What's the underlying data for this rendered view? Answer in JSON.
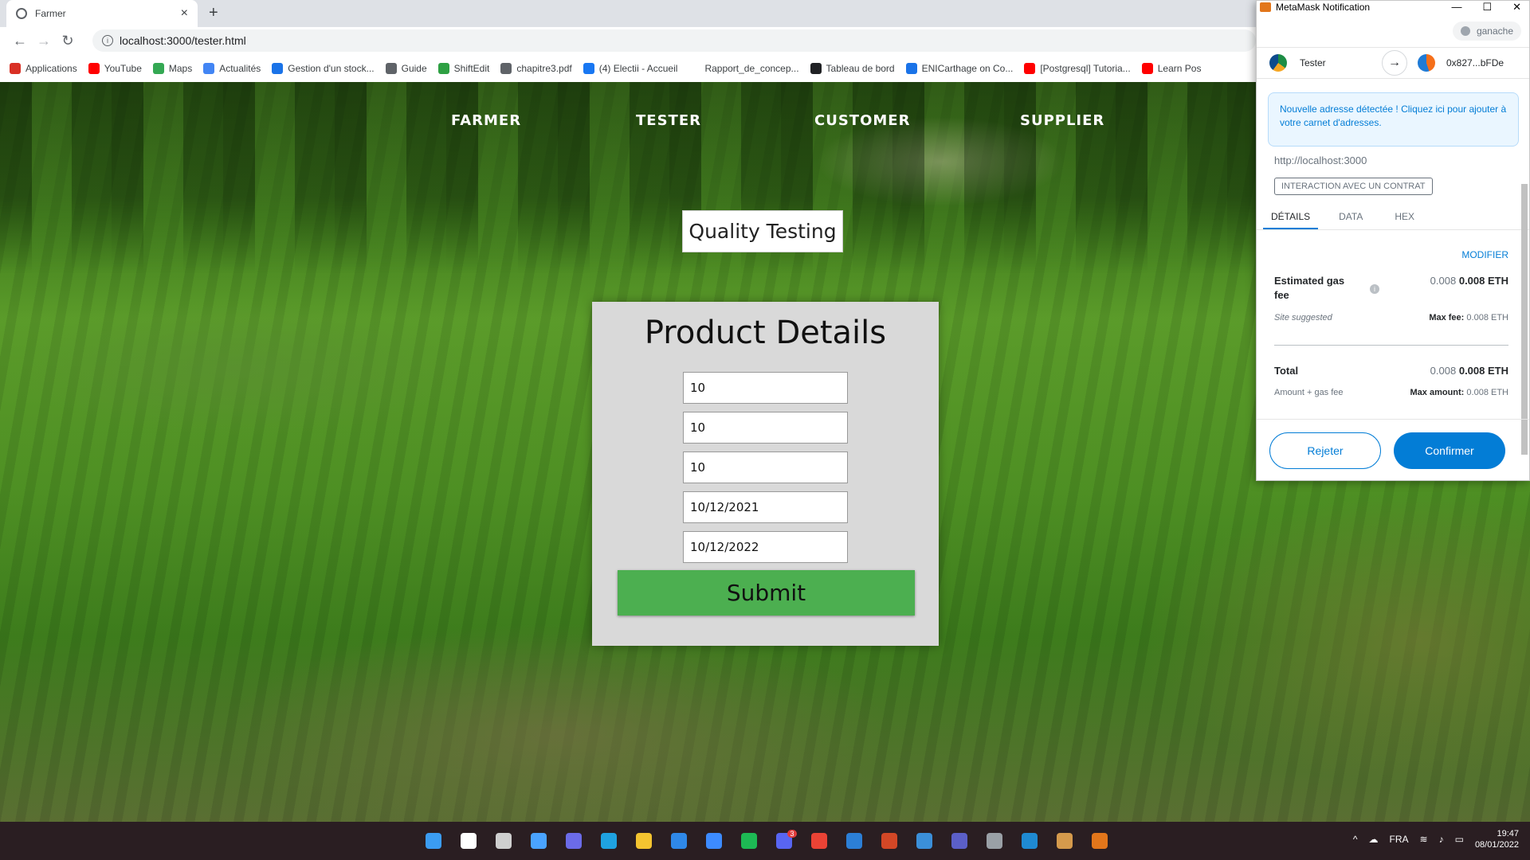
{
  "browser": {
    "tab_title": "Farmer",
    "new_tab": "+",
    "tab_close": "×",
    "url": "localhost:3000/tester.html",
    "nav": {
      "back": "←",
      "forward": "→",
      "reload": "↻"
    },
    "bookmarks": [
      {
        "label": "Applications",
        "color": "#d93025"
      },
      {
        "label": "YouTube",
        "color": "#ff0000"
      },
      {
        "label": "Maps",
        "color": "#34a853"
      },
      {
        "label": "Actualités",
        "color": "#4285f4"
      },
      {
        "label": "Gestion d'un stock...",
        "color": "#1a73e8"
      },
      {
        "label": "Guide",
        "color": "#5f6368"
      },
      {
        "label": "ShiftEdit",
        "color": "#2ea043"
      },
      {
        "label": "chapitre3.pdf",
        "color": "#5f6368"
      },
      {
        "label": "(4) Electii - Accueil",
        "color": "#1877f2"
      },
      {
        "label": "Rapport_de_concep...",
        "color": "#ffffff"
      },
      {
        "label": "Tableau de bord",
        "color": "#202124"
      },
      {
        "label": "ENICarthage on Co...",
        "color": "#1a73e8"
      },
      {
        "label": "[Postgresql] Tutoria...",
        "color": "#ff0000"
      },
      {
        "label": "Learn Pos",
        "color": "#ff0000"
      }
    ]
  },
  "page": {
    "nav": [
      "FARMER",
      "TESTER",
      "CUSTOMER",
      "SUPPLIER"
    ],
    "section_label": "Quality Testing",
    "card_title": "Product Details",
    "fields": [
      "10",
      "10",
      "10",
      "10/12/2021",
      "10/12/2022"
    ],
    "submit_label": "Submit"
  },
  "metamask": {
    "window_title": "MetaMask Notification",
    "window_controls": [
      "—",
      "☐",
      "✕"
    ],
    "network": "ganache",
    "from_account": "Tester",
    "to_account": "0x827...bFDe",
    "arrow": "→",
    "banner": "Nouvelle adresse détectée ! Cliquez ici pour ajouter à votre carnet d'adresses.",
    "origin": "http://localhost:3000",
    "badge": "INTERACTION AVEC UN CONTRAT",
    "tabs": [
      "DÉTAILS",
      "DATA",
      "HEX"
    ],
    "active_tab": "DÉTAILS",
    "modify": "MODIFIER",
    "gas_label": "Estimated gas fee",
    "gas_value_light": "0.008",
    "gas_value_bold": "0.008 ETH",
    "site_suggested": "Site suggested",
    "max_fee_label": "Max fee:",
    "max_fee_value": "0.008 ETH",
    "total_label": "Total",
    "total_value_light": "0.008",
    "total_value_bold": "0.008 ETH",
    "amount_gas": "Amount + gas fee",
    "max_amount_label": "Max amount:",
    "max_amount_value": "0.008 ETH",
    "reject": "Rejeter",
    "confirm": "Confirmer"
  },
  "taskbar": {
    "icons": [
      "windows-start-icon",
      "search-icon",
      "task-view-icon",
      "widgets-icon",
      "teams-chat-icon",
      "edge-icon",
      "file-explorer-icon",
      "mail-icon",
      "todo-icon",
      "spotify-icon",
      "discord-icon",
      "chrome-icon",
      "photos-icon",
      "powerpoint-icon",
      "remote-desktop-icon",
      "teams-icon",
      "settings-icon",
      "vscode-icon",
      "package-icon",
      "metamask-icon"
    ],
    "discord_badge": "3",
    "language": "FRA",
    "time": "19:47",
    "date": "08/01/2022"
  }
}
